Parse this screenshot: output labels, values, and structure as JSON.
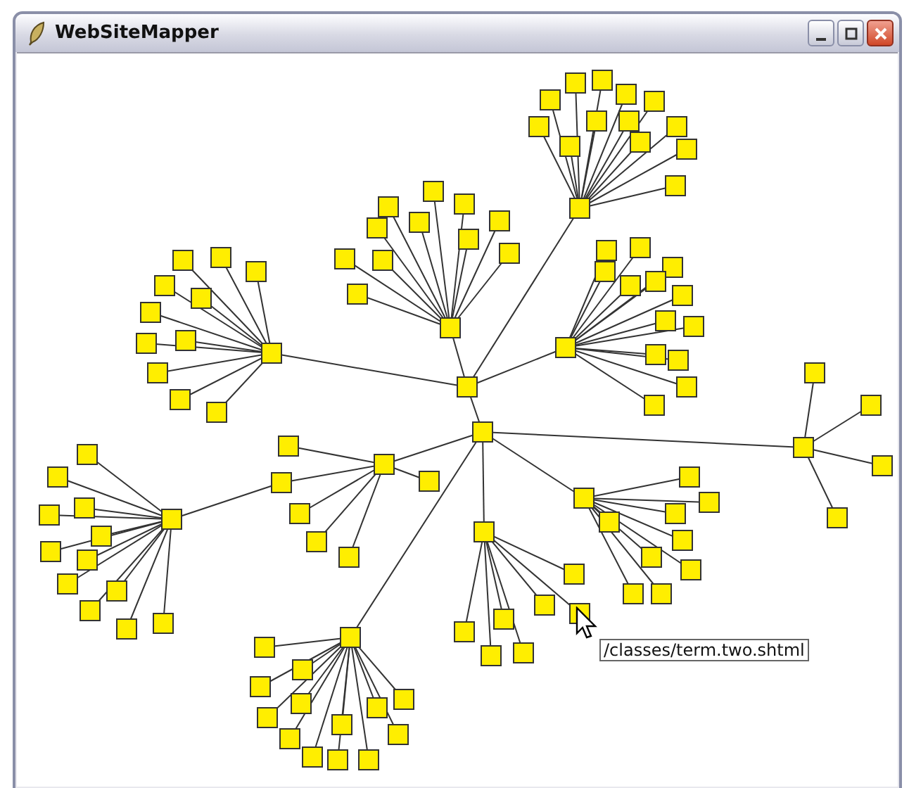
{
  "window": {
    "title": "WebSiteMapper"
  },
  "tooltip": {
    "text": "/classes/term.two.shtml"
  }
}
